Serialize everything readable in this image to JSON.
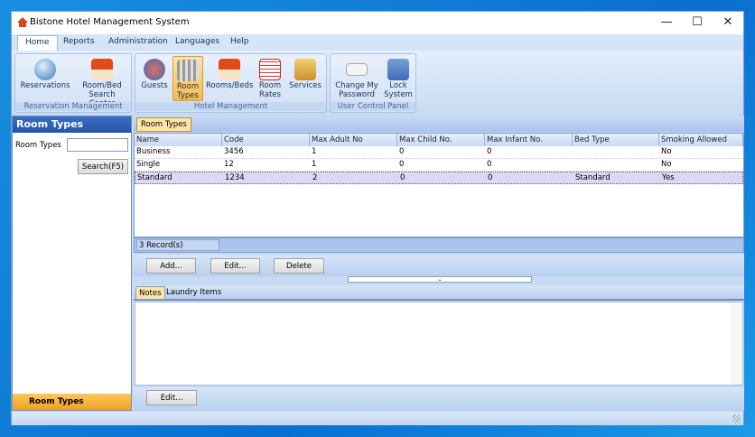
{
  "window": {
    "title": "Bistone Hotel Management System",
    "minimize": "—",
    "maximize": "☐",
    "close": "✕"
  },
  "menu_tabs": [
    "Home",
    "Reports",
    "Administration",
    "Languages",
    "Help"
  ],
  "ribbon": {
    "groups": [
      {
        "label": "Reservation Management",
        "buttons": [
          "Reservations",
          "Room/Bed Search Center"
        ]
      },
      {
        "label": "Hotel Management",
        "buttons": [
          "Guests",
          "Room Types",
          "Rooms/Beds",
          "Room Rates",
          "Services"
        ]
      },
      {
        "label": "User Control Panel",
        "buttons": [
          "Change My Password",
          "Lock System"
        ]
      }
    ]
  },
  "left_panel": {
    "title": "Room Types",
    "field_label": "Room Types",
    "field_value": "",
    "search_button": "Search(F5)",
    "footer": "Room Types"
  },
  "main": {
    "tab": "Room Types",
    "columns": [
      "Name",
      "Code",
      "Max Adult No",
      "Max Child No.",
      "Max Infant No.",
      "Bed Type",
      "Smoking Allowed"
    ],
    "rows": [
      [
        "Business",
        "3456",
        "1",
        "0",
        "0",
        "",
        "No"
      ],
      [
        "Single",
        "12",
        "1",
        "0",
        "0",
        "",
        "No"
      ],
      [
        "Standard",
        "1234",
        "2",
        "0",
        "0",
        "Standard",
        "Yes"
      ]
    ],
    "selected_row": 2,
    "record_count": "3 Record(s)",
    "buttons": {
      "add": "Add...",
      "edit": "Edit...",
      "delete": "Delete"
    },
    "detail_tabs": [
      "Notes",
      "Laundry Items"
    ],
    "notes_text": "",
    "notes_edit": "Edit..."
  }
}
